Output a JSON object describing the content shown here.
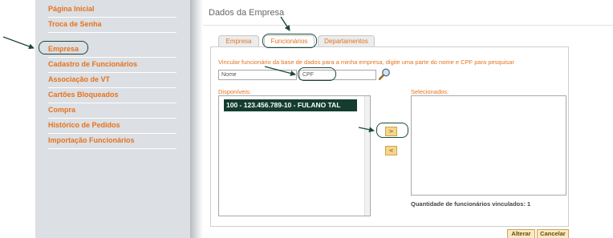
{
  "sidebar": {
    "items": [
      {
        "label": "Página Inicial"
      },
      {
        "label": "Troca de Senha"
      },
      {
        "label": "Empresa"
      },
      {
        "label": "Cadastro de Funcionários"
      },
      {
        "label": "Associação de VT"
      },
      {
        "label": "Cartões Bloqueados"
      },
      {
        "label": "Compra"
      },
      {
        "label": "Histórico de Pedidos"
      },
      {
        "label": "Importação Funcionários"
      }
    ],
    "active_index": 2
  },
  "header": {
    "title": "Dados da Empresa"
  },
  "tabs": [
    {
      "label": "Empresa"
    },
    {
      "label": "Funcionários"
    },
    {
      "label": "Departamentos"
    }
  ],
  "active_tab": "Funcionários",
  "search": {
    "instruction": "Vincular funcionário da base de dados para a minha empresa, digite uma parte do nome e CPF para pesquisar",
    "name_value": "Nome",
    "cpf_value": "CPF",
    "search_icon": "magnifier-icon"
  },
  "available": {
    "label": "Disponíveis:",
    "items": [
      {
        "text": "100 - 123.456.789-10 - FULANO TAL"
      }
    ]
  },
  "selected": {
    "label": "Selecionados:",
    "items": []
  },
  "move_buttons": {
    "add": ">",
    "remove": "<"
  },
  "linked_count": "Quantidade de funcionários vinculados: 1",
  "actions": {
    "save": "Alterar",
    "cancel": "Cancelar"
  },
  "colors": {
    "accent": "#e4731f",
    "sidebar_bg": "#dcdfe3",
    "highlight_row": "#143d30",
    "annotation": "#1d4a3a",
    "button_bg": "#f7d58c"
  },
  "annotations": {
    "arrow_targets": [
      "sidebar-item-empresa",
      "tab-funcionarios",
      "cpf-input",
      "add-button"
    ]
  }
}
